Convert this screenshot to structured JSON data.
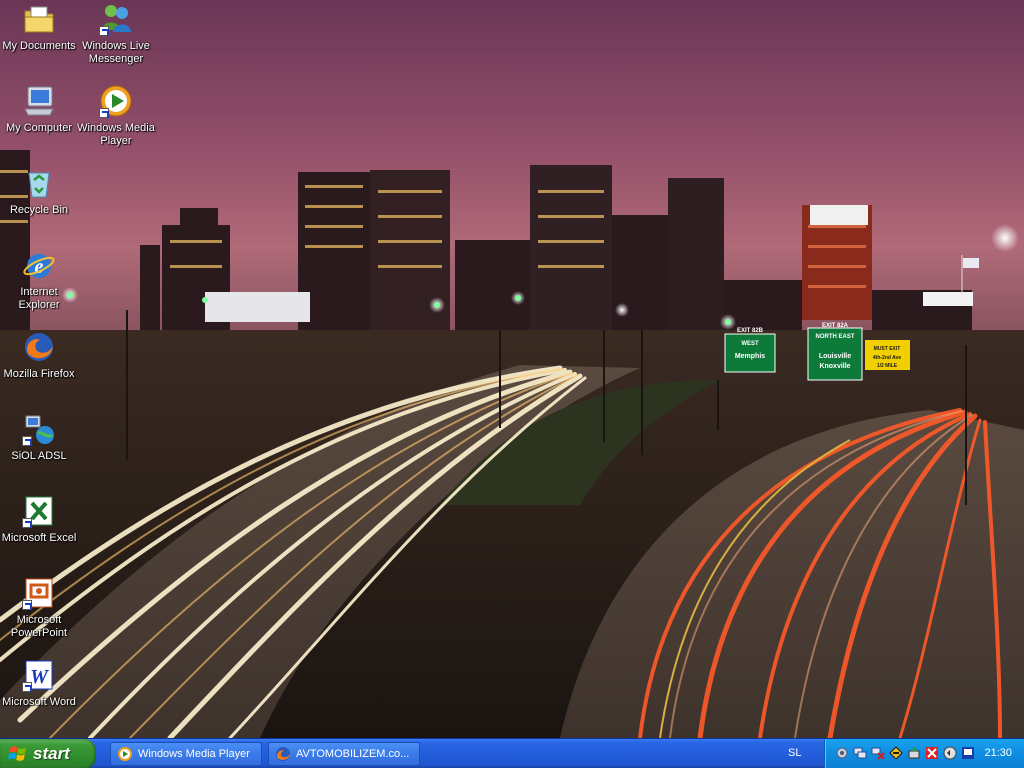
{
  "desktop": {
    "icons": [
      {
        "label": "My Documents",
        "icon": "my-documents-icon"
      },
      {
        "label": "Windows Live Messenger",
        "icon": "messenger-icon"
      },
      {
        "label": "My Computer",
        "icon": "my-computer-icon"
      },
      {
        "label": "Windows Media Player",
        "icon": "media-player-icon"
      },
      {
        "label": "Recycle Bin",
        "icon": "recycle-bin-icon"
      },
      {
        "label": "Internet Explorer",
        "icon": "internet-explorer-icon"
      },
      {
        "label": "Mozilla Firefox",
        "icon": "firefox-icon"
      },
      {
        "label": "SiOL ADSL",
        "icon": "network-connection-icon"
      },
      {
        "label": "Microsoft Excel",
        "icon": "excel-icon"
      },
      {
        "label": "Microsoft PowerPoint",
        "icon": "powerpoint-icon"
      },
      {
        "label": "Microsoft Word",
        "icon": "word-icon"
      }
    ]
  },
  "wallpaper": {
    "signs": {
      "exit_left": "EXIT 82B",
      "left_dir": "WEST",
      "left_city": "Memphis",
      "exit_right": "EXIT 82A",
      "right_dir": "NORTH EAST",
      "right_city1": "Louisville",
      "right_city2": "Knoxville",
      "yellow1": "MUST EXIT",
      "yellow2": "4th-2nd Ave",
      "yellow3": "1/2 MILE"
    }
  },
  "taskbar": {
    "start_label": "start",
    "tasks": [
      {
        "label": "Windows Media Player",
        "icon": "media-player-icon"
      },
      {
        "label": "AVTOMOBILIZEM.co...",
        "icon": "firefox-icon"
      }
    ],
    "language": "SL",
    "clock": "21:30"
  },
  "colors": {
    "taskbar_blue": "#245edc",
    "start_green": "#3c9b38",
    "tray_blue": "#0f8ce0"
  }
}
